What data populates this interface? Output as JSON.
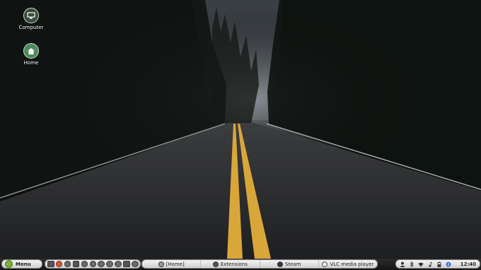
{
  "desktop": {
    "icons": [
      {
        "label": "Computer",
        "icon": "computer-icon"
      },
      {
        "label": "Home",
        "icon": "home-folder-icon"
      }
    ]
  },
  "panel": {
    "menu_label": "Menu",
    "launchers": [
      "show-desktop-icon",
      "firefox-icon",
      "app-icon",
      "app-icon",
      "app-icon",
      "app-icon",
      "app-icon",
      "app-icon",
      "app-icon",
      "app-icon",
      "app-icon"
    ],
    "tasks": [
      {
        "label": "[Home]",
        "icon": "folder-icon"
      },
      {
        "label": "Extensions",
        "icon": "extensions-icon"
      },
      {
        "label": "Steam",
        "icon": "steam-icon"
      },
      {
        "label": "VLC media player",
        "icon": "vlc-icon"
      }
    ],
    "tray": {
      "icons": [
        "user-icon",
        "bluetooth-icon",
        "wifi-icon",
        "volume-icon",
        "battery-icon",
        "update-icon"
      ],
      "clock": "12:40"
    }
  },
  "colors": {
    "panel_bg": "#1e1e1e",
    "mint_green": "#7fb13a"
  }
}
